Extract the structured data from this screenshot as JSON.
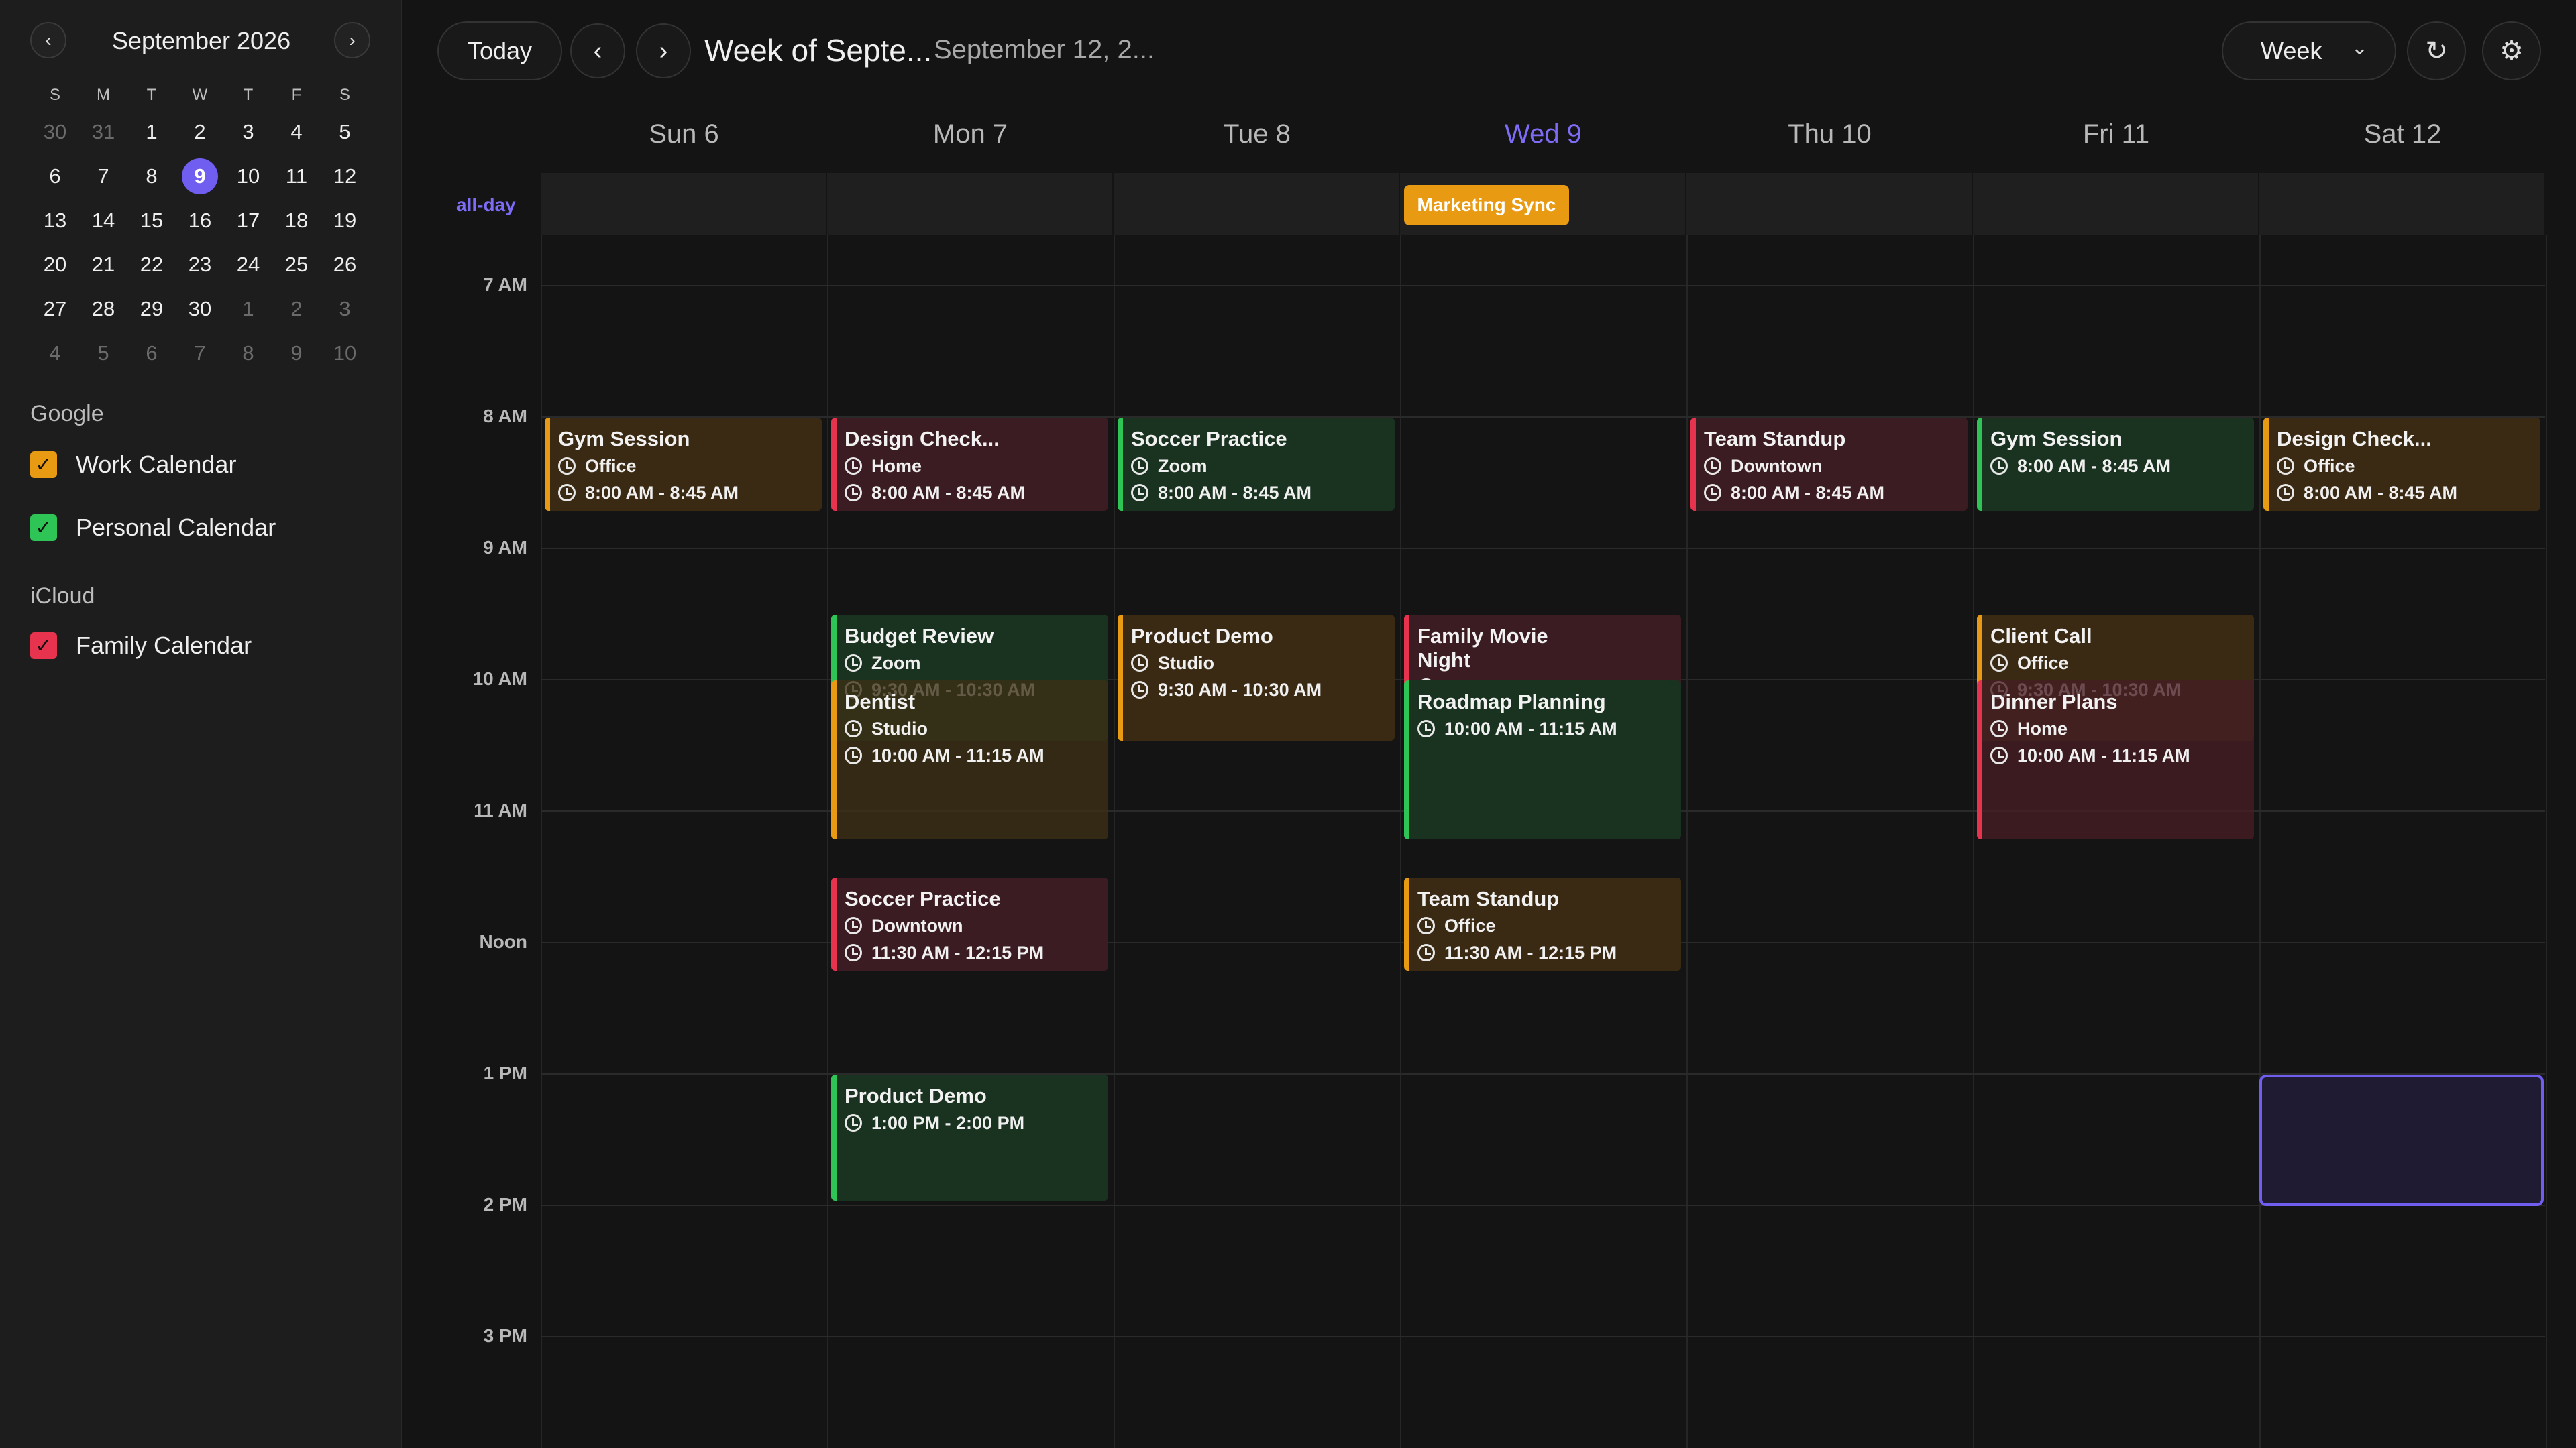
{
  "mini_calendar": {
    "month_title": "September 2026",
    "prev_icon": "chevron-left-icon",
    "next_icon": "chevron-right-icon",
    "dow": [
      "S",
      "M",
      "T",
      "W",
      "T",
      "F",
      "S"
    ],
    "weeks": [
      [
        {
          "d": "30",
          "dim": true
        },
        {
          "d": "31",
          "dim": true
        },
        {
          "d": "1"
        },
        {
          "d": "2"
        },
        {
          "d": "3"
        },
        {
          "d": "4"
        },
        {
          "d": "5"
        }
      ],
      [
        {
          "d": "6"
        },
        {
          "d": "7"
        },
        {
          "d": "8"
        },
        {
          "d": "9",
          "today": true
        },
        {
          "d": "10"
        },
        {
          "d": "11"
        },
        {
          "d": "12"
        }
      ],
      [
        {
          "d": "13"
        },
        {
          "d": "14"
        },
        {
          "d": "15"
        },
        {
          "d": "16"
        },
        {
          "d": "17"
        },
        {
          "d": "18"
        },
        {
          "d": "19"
        }
      ],
      [
        {
          "d": "20"
        },
        {
          "d": "21"
        },
        {
          "d": "22"
        },
        {
          "d": "23"
        },
        {
          "d": "24"
        },
        {
          "d": "25"
        },
        {
          "d": "26"
        }
      ],
      [
        {
          "d": "27"
        },
        {
          "d": "28"
        },
        {
          "d": "29"
        },
        {
          "d": "30"
        },
        {
          "d": "1",
          "dim": true
        },
        {
          "d": "2",
          "dim": true
        },
        {
          "d": "3",
          "dim": true
        }
      ],
      [
        {
          "d": "4",
          "dim": true
        },
        {
          "d": "5",
          "dim": true
        },
        {
          "d": "6",
          "dim": true
        },
        {
          "d": "7",
          "dim": true
        },
        {
          "d": "8",
          "dim": true
        },
        {
          "d": "9",
          "dim": true
        },
        {
          "d": "10",
          "dim": true
        }
      ]
    ]
  },
  "calendar_groups": {
    "google": {
      "label": "Google",
      "calendars": [
        {
          "name": "Work Calendar",
          "color": "#e89a12",
          "checked": true
        },
        {
          "name": "Personal Calendar",
          "color": "#2fc556",
          "checked": true
        }
      ]
    },
    "icloud": {
      "label": "iCloud",
      "calendars": [
        {
          "name": "Family Calendar",
          "color": "#e8334f",
          "checked": true
        }
      ]
    }
  },
  "toolbar": {
    "today_label": "Today",
    "prev_icon": "chevron-left-icon",
    "next_icon": "chevron-right-icon",
    "week_title": "Week of Septe...",
    "week_subtitle": "September 12, 2...",
    "view_select": "Week",
    "view_chevron_icon": "chevron-down-icon",
    "refresh_icon": "refresh-icon",
    "settings_icon": "gear-icon"
  },
  "week": {
    "days": [
      {
        "label": "Sun 6"
      },
      {
        "label": "Mon 7"
      },
      {
        "label": "Tue 8"
      },
      {
        "label": "Wed 9",
        "today": true
      },
      {
        "label": "Thu 10"
      },
      {
        "label": "Fri 11"
      },
      {
        "label": "Sat 12"
      }
    ],
    "allday_label": "all-day",
    "allday_events": [
      {
        "title": "Marketing Sync",
        "day": 3,
        "color": "#e89a12"
      }
    ],
    "hour_labels": [
      "7 AM",
      "8 AM",
      "9 AM",
      "10 AM",
      "11 AM",
      "Noon",
      "1 PM",
      "2 PM",
      "3 PM"
    ]
  },
  "events": [
    {
      "title": "Gym Session",
      "location": "Office",
      "time": "8:00 AM - 8:45 AM",
      "day": 0,
      "start": 8.0,
      "end": 8.75,
      "calendar": "Work Calendar"
    },
    {
      "title": "Design Check...",
      "location": "Home",
      "time": "8:00 AM - 8:45 AM",
      "day": 1,
      "start": 8.0,
      "end": 8.75,
      "calendar": "Family Calendar"
    },
    {
      "title": "Soccer Practice",
      "location": "Zoom",
      "time": "8:00 AM - 8:45 AM",
      "day": 2,
      "start": 8.0,
      "end": 8.75,
      "calendar": "Personal Calendar"
    },
    {
      "title": "Team Standup",
      "location": "Downtown",
      "time": "8:00 AM - 8:45 AM",
      "day": 4,
      "start": 8.0,
      "end": 8.75,
      "calendar": "Family Calendar"
    },
    {
      "title": "Gym Session",
      "location": "",
      "time": "8:00 AM - 8:45 AM",
      "day": 5,
      "start": 8.0,
      "end": 8.75,
      "calendar": "Personal Calendar"
    },
    {
      "title": "Design Check...",
      "location": "Office",
      "time": "8:00 AM - 8:45 AM",
      "day": 6,
      "start": 8.0,
      "end": 8.75,
      "calendar": "Work Calendar"
    },
    {
      "title": "Budget Review",
      "location": "Zoom",
      "time": "9:30 AM - 10:30 AM",
      "day": 1,
      "start": 9.5,
      "end": 10.5,
      "calendar": "Personal Calendar"
    },
    {
      "title": "Dentist",
      "location": "Studio",
      "time": "10:00 AM - 11:15 AM",
      "day": 1,
      "start": 10.0,
      "end": 11.25,
      "calendar": "Work Calendar",
      "overlay": true
    },
    {
      "title": "Product Demo",
      "location": "Studio",
      "time": "9:30 AM - 10:30 AM",
      "day": 2,
      "start": 9.5,
      "end": 10.5,
      "calendar": "Work Calendar"
    },
    {
      "title": "Family Movie Night",
      "location": "Downtown",
      "time": "9:30 AM - 10:30 AM",
      "day": 3,
      "start": 9.5,
      "end": 10.5,
      "calendar": "Family Calendar"
    },
    {
      "title": "Roadmap Planning",
      "location": "",
      "time": "10:00 AM - 11:15 AM",
      "day": 3,
      "start": 10.0,
      "end": 11.25,
      "calendar": "Personal Calendar",
      "overlay": true
    },
    {
      "title": "Client Call",
      "location": "Office",
      "time": "9:30 AM - 10:30 AM",
      "day": 5,
      "start": 9.5,
      "end": 10.5,
      "calendar": "Work Calendar"
    },
    {
      "title": "Dinner Plans",
      "location": "Home",
      "time": "10:00 AM - 11:15 AM",
      "day": 5,
      "start": 10.0,
      "end": 11.25,
      "calendar": "Family Calendar",
      "overlay": true
    },
    {
      "title": "Soccer Practice",
      "location": "Downtown",
      "time": "11:30 AM - 12:15 PM",
      "day": 1,
      "start": 11.5,
      "end": 12.25,
      "calendar": "Family Calendar"
    },
    {
      "title": "Team Standup",
      "location": "Office",
      "time": "11:30 AM - 12:15 PM",
      "day": 3,
      "start": 11.5,
      "end": 12.25,
      "calendar": "Work Calendar"
    },
    {
      "title": "Product Demo",
      "location": "",
      "time": "1:00 PM - 2:00 PM",
      "day": 1,
      "start": 13.0,
      "end": 14.0,
      "calendar": "Personal Calendar"
    }
  ],
  "selection": {
    "day": 6,
    "start": 13.0,
    "end": 14.0
  }
}
